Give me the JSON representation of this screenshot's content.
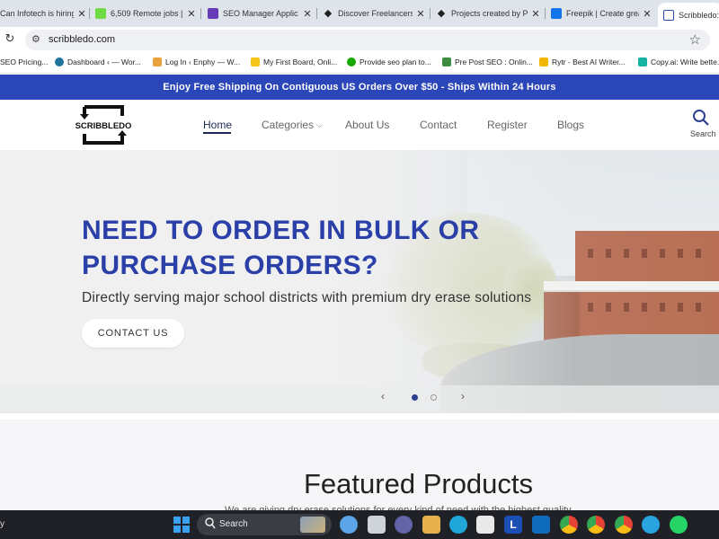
{
  "browser": {
    "tabs": [
      {
        "title": "Can Infotech is hiring",
        "favicon": "generic-favicon",
        "color": "#c44"
      },
      {
        "title": "6,509 Remote jobs | U",
        "favicon": "upwork-favicon",
        "color": "#6fda44"
      },
      {
        "title": "SEO Manager Applic",
        "favicon": "form-favicon",
        "color": "#673ab7"
      },
      {
        "title": "Discover Freelancers",
        "favicon": "freelancer-favicon",
        "color": "#222"
      },
      {
        "title": "Projects created by P",
        "favicon": "freelancer-favicon",
        "color": "#222"
      },
      {
        "title": "Freepik | Create grea",
        "favicon": "freepik-favicon",
        "color": "#1273eb"
      },
      {
        "title": "Scribbledo: P",
        "favicon": "scribbledo-favicon",
        "color": "#2b46b8",
        "active": true
      }
    ],
    "url": "scribbledo.com",
    "bookmarks": [
      {
        "label": "SEO Pricing...",
        "color": "#999"
      },
      {
        "label": "Dashboard ‹ — Wor...",
        "color": "#21759b"
      },
      {
        "label": "Log In ‹ Enphy — W...",
        "color": "#e8a23d"
      },
      {
        "label": "My First Board, Onli...",
        "color": "#f5c518"
      },
      {
        "label": "Provide seo plan to...",
        "color": "#14a800"
      },
      {
        "label": "Pre Post SEO : Onlin...",
        "color": "#3d8c40"
      },
      {
        "label": "Rytr - Best AI Writer...",
        "color": "#f2b705"
      },
      {
        "label": "Copy.ai: Write bette...",
        "color": "#16b3a5"
      }
    ]
  },
  "site": {
    "promo": "Enjoy Free Shipping On Contiguous US Orders Over $50 - Ships Within 24 Hours",
    "logo_text": "SCRIBBLEDO",
    "nav": {
      "home": "Home",
      "categories": "Categories",
      "about": "About Us",
      "contact": "Contact",
      "register": "Register",
      "blogs": "Blogs"
    },
    "search_label": "Search",
    "hero": {
      "heading": "NEED TO ORDER IN BULK OR PURCHASE ORDERS?",
      "subheading": "Directly serving major school districts with premium dry erase solutions",
      "cta": "CONTACT US",
      "slide_count": 2,
      "active_slide": 1
    },
    "featured": {
      "title": "Featured Products",
      "cut_text": "We are giving dry erase solutions for every kind of need with the highest quality"
    },
    "brand_color": "#2b46b8"
  },
  "taskbar": {
    "left_text": "y",
    "search_label": "Search",
    "apps": [
      {
        "name": "copilot",
        "color": "#5ba4e5"
      },
      {
        "name": "file-explorer",
        "color": "#f2c94c"
      },
      {
        "name": "teams",
        "color": "#6264a7"
      },
      {
        "name": "folder",
        "color": "#e8b04a"
      },
      {
        "name": "edge",
        "color": "#1fa5d6"
      },
      {
        "name": "store",
        "color": "#e9e9e9"
      },
      {
        "name": "app-l",
        "color": "#1b4fb5"
      },
      {
        "name": "outlook",
        "color": "#0f6cbd"
      },
      {
        "name": "chrome-1",
        "color": "#e54335"
      },
      {
        "name": "chrome-2",
        "color": "#e54335"
      },
      {
        "name": "chrome-3",
        "color": "#e54335"
      },
      {
        "name": "telegram",
        "color": "#2aa3df"
      },
      {
        "name": "whatsapp",
        "color": "#25d366"
      }
    ]
  }
}
